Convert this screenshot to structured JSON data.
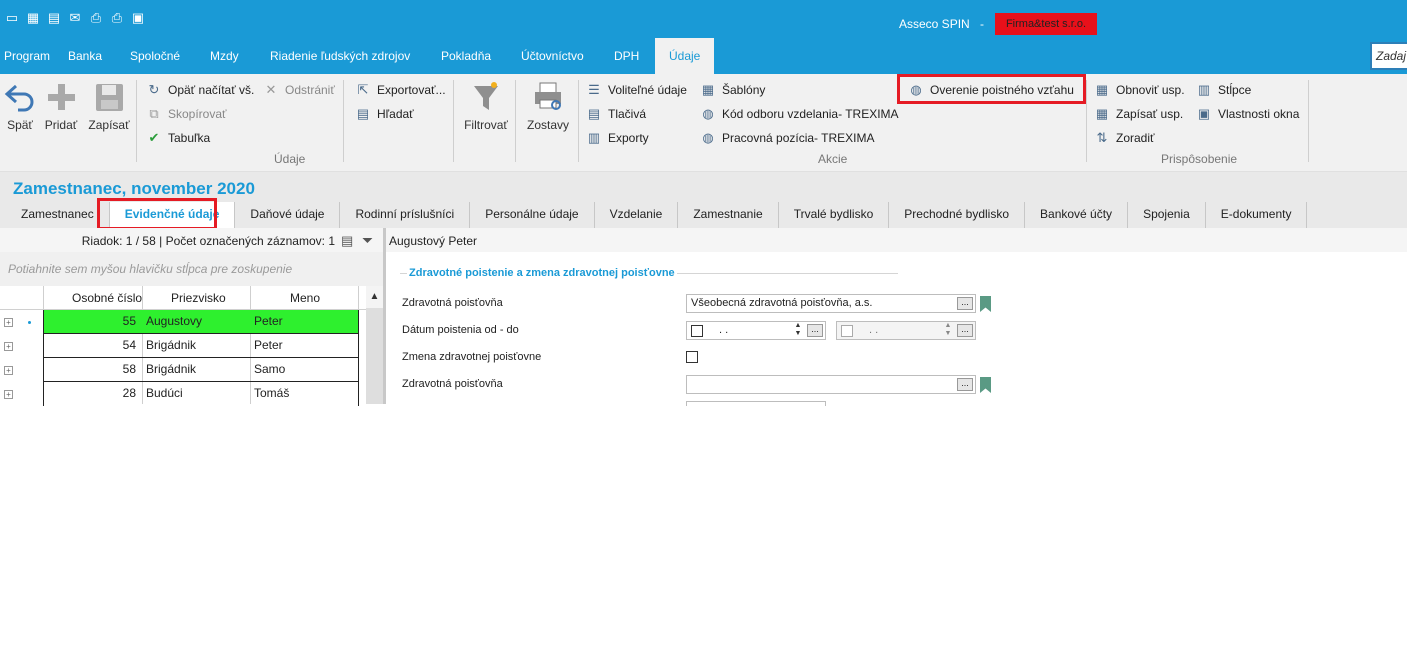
{
  "titlebar": {
    "app_name": "Asseco SPIN",
    "separator": "-",
    "company": "Firma&test s.r.o.",
    "quick_access_icons": [
      "restore-icon",
      "excel-icon",
      "word-icon",
      "email-icon",
      "print-icon",
      "print-preview-icon",
      "export-file-icon"
    ]
  },
  "menu": {
    "items": [
      "Program",
      "Banka",
      "Spoločné",
      "Mzdy",
      "Riadenie ľudských zdrojov",
      "Pokladňa",
      "Účtovníctvo",
      "DPH",
      "Údaje"
    ],
    "search_placeholder": "Zadaj"
  },
  "ribbon": {
    "back": "Späť",
    "add": "Pridať",
    "save": "Zapísať",
    "reload": "Opäť načítať vš.",
    "remove": "Odstrániť",
    "copy": "Skopírovať",
    "table": "Tabuľka",
    "export_more": "Exportovať...",
    "find": "Hľadať",
    "group_data": "Údaje",
    "filter": "Filtrovať",
    "reports": "Zostavy",
    "optional_data": "Voliteľné údaje",
    "prints": "Tlačivá",
    "exports": "Exporty",
    "templates": "Šablóny",
    "education_code": "Kód odboru vzdelania- TREXIMA",
    "work_position": "Pracovná pozícia- TREXIMA",
    "verify_insurance": "Overenie poistného vzťahu",
    "group_actions": "Akcie",
    "refresh_layout": "Obnoviť usp.",
    "save_layout": "Zapísať usp.",
    "sort": "Zoradiť",
    "columns": "Stĺpce",
    "window_props": "Vlastnosti okna",
    "group_customize": "Prispôsobenie"
  },
  "colors": {
    "accent": "#1a9ad6",
    "highlight_red": "#e51b24",
    "selected_row": "#2ef02e",
    "company_badge": "#e8101a"
  },
  "page": {
    "title": "Zamestnanec, november 2020",
    "tabs": [
      "Zamestnanec",
      "Evidenčné údaje",
      "Daňové údaje",
      "Rodinní príslušníci",
      "Personálne údaje",
      "Vzdelanie",
      "Zamestnanie",
      "Trvalé bydlisko",
      "Prechodné bydlisko",
      "Bankové účty",
      "Spojenia",
      "E-dokumenty"
    ]
  },
  "grid": {
    "row_info": "Riadok: 1 / 58 | Počet označených záznamov: 1",
    "group_hint": "Potiahnite sem myšou hlavičku stĺpca pre zoskupenie",
    "columns": [
      "Osobné číslo",
      "Priezvisko",
      "Meno"
    ],
    "rows": [
      {
        "id": "55",
        "surname": "Augustovy",
        "name": "Peter"
      },
      {
        "id": "54",
        "surname": "Brigádnik",
        "name": "Peter"
      },
      {
        "id": "58",
        "surname": "Brigádnik",
        "name": "Samo"
      },
      {
        "id": "28",
        "surname": "Budúci",
        "name": "Tomáš"
      }
    ]
  },
  "detail": {
    "employee_name": "Augustový Peter",
    "section_title": "Zdravotné poistenie a zmena zdravotnej poisťovne",
    "label_insurer": "Zdravotná poisťovňa",
    "insurer_value": "Všeobecná zdravotná poisťovňa, a.s.",
    "label_date_range": "Dátum poistenia od - do",
    "date_from": ". .",
    "date_to": ". .",
    "label_change": "Zmena zdravotnej poisťovne",
    "label_insurer2": "Zdravotná poisťovňa",
    "insurer2_value": "",
    "ellipsis": "..."
  }
}
